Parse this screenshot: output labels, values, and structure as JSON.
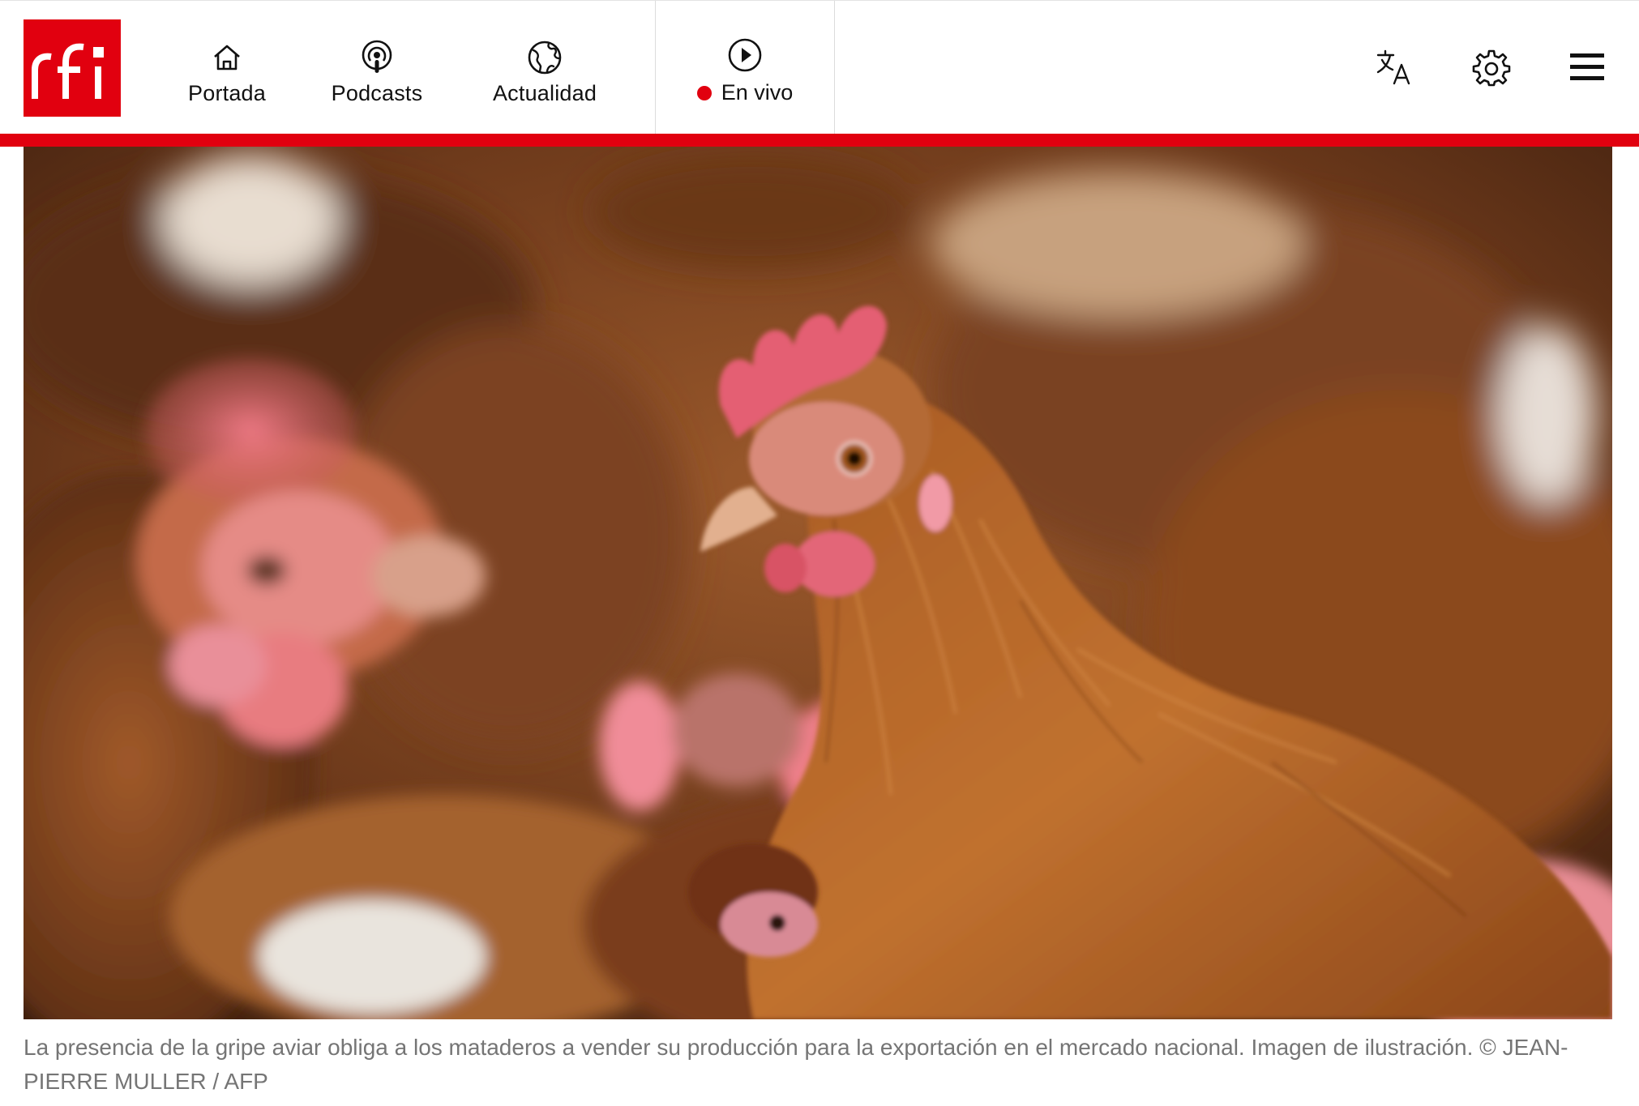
{
  "header": {
    "logo_text": "rfi",
    "brand_color": "#e1000f",
    "nav": [
      {
        "label": "Portada",
        "icon": "home-icon"
      },
      {
        "label": "Podcasts",
        "icon": "podcast-icon"
      },
      {
        "label": "Actualidad",
        "icon": "globe-icon"
      }
    ],
    "live": {
      "label": "En vivo",
      "icon": "play-icon",
      "status_color": "#e1000f"
    },
    "tools": [
      {
        "icon": "translate-icon"
      },
      {
        "icon": "settings-gear-icon"
      },
      {
        "icon": "hamburger-menu-icon"
      }
    ]
  },
  "article": {
    "image": {
      "subject": "hens"
    },
    "caption": "La presencia de la gripe aviar obliga a los mataderos a vender su producción para la exportación en el mercado nacional. Imagen de ilustración. © JEAN-PIERRE MULLER / AFP"
  }
}
